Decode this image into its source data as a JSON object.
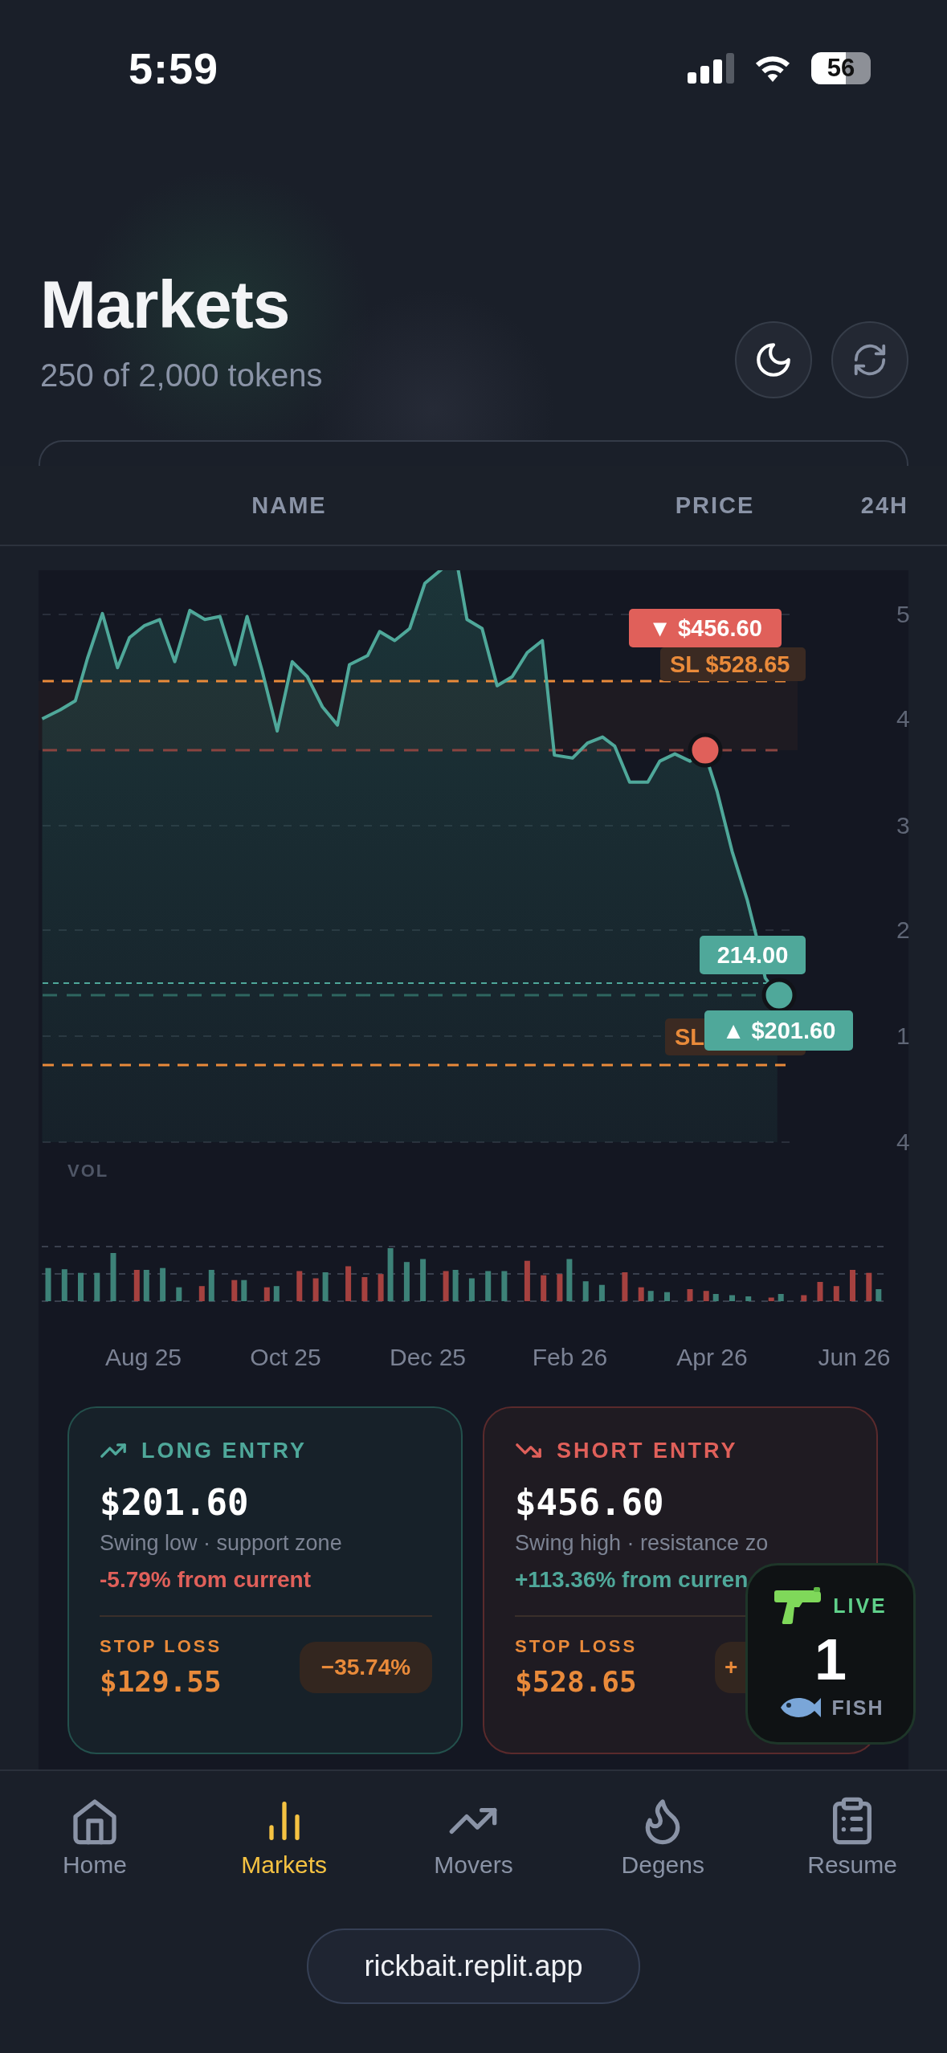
{
  "status_bar": {
    "time": "5:59",
    "battery": "56"
  },
  "header": {
    "title": "Markets",
    "subtitle": "250 of 2,000 tokens",
    "buttons": [
      {
        "kind": "theme"
      },
      {
        "kind": "refresh"
      }
    ]
  },
  "table": {
    "columns": [
      "NAME",
      "PRICE",
      "24H"
    ]
  },
  "chart": {
    "y_axis_labels": [
      "5",
      "4",
      "3",
      "2",
      "1",
      "4"
    ],
    "tags": [
      {
        "kind": "short",
        "text": "▼ $456.60"
      },
      {
        "kind": "stop",
        "text": "SL $528.65"
      },
      {
        "kind": "current",
        "text": "214.00"
      },
      {
        "kind": "stop",
        "text": "SL"
      },
      {
        "kind": "long",
        "text": "▲ $201.60"
      }
    ],
    "volume_label": "VOL",
    "x_labels": [
      "Aug 25",
      "Oct 25",
      "Dec 25",
      "Feb 26",
      "Apr 26",
      "Jun 26"
    ]
  },
  "entries": [
    {
      "kind": "long",
      "title": "LONG ENTRY",
      "price": "$201.60",
      "note": "Swing low · support zone",
      "change": "-5.79% from current",
      "stop_label": "STOP LOSS",
      "stop_price": "$129.55",
      "stop_change": "−35.74%"
    },
    {
      "kind": "short",
      "title": "SHORT ENTRY",
      "price": "$456.60",
      "note": "Swing high · resistance zo",
      "change": "+113.36% from curren",
      "stop_label": "STOP LOSS",
      "stop_price": "$528.65",
      "stop_change": "+"
    }
  ],
  "live_badge": {
    "label": "LIVE",
    "count": "1",
    "sub": "FISH"
  },
  "nav": [
    {
      "label": "Home",
      "kind": "home",
      "selected": false
    },
    {
      "label": "Markets",
      "kind": "markets",
      "selected": true
    },
    {
      "label": "Movers",
      "kind": "movers",
      "selected": false
    },
    {
      "label": "Degens",
      "kind": "degens",
      "selected": false
    },
    {
      "label": "Resume",
      "kind": "resume",
      "selected": false
    }
  ],
  "url_bar": {
    "text": "rickbait.replit.app"
  }
}
